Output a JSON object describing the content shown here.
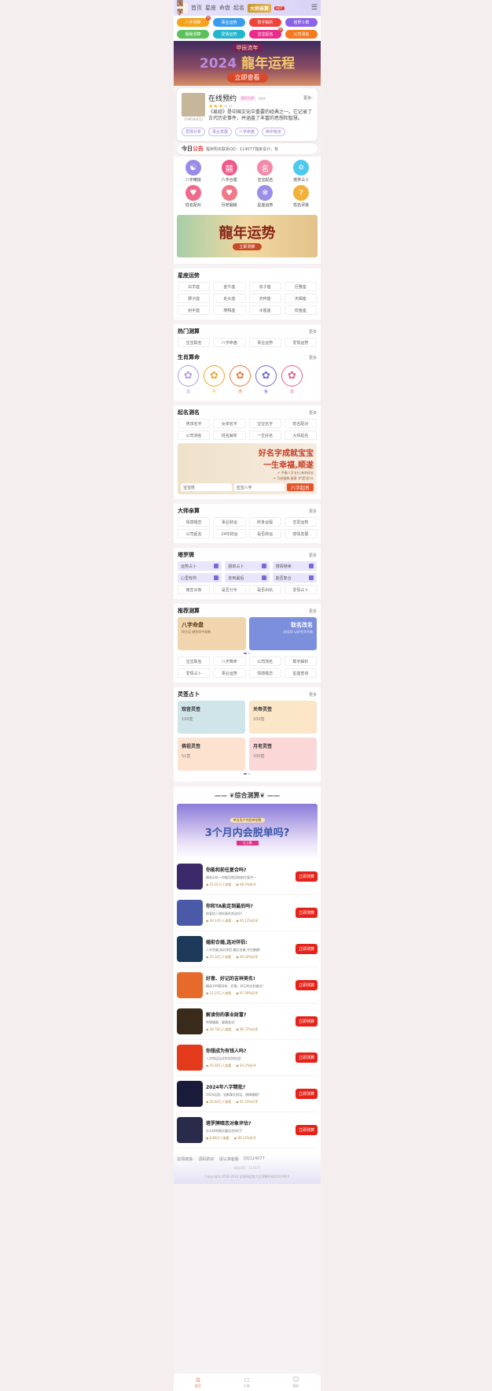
{
  "header": {
    "logo": "国学",
    "nav": [
      "首页",
      "星座",
      "命盘",
      "起名"
    ],
    "master_label": "大师亲算",
    "hot_badge": "HOT",
    "menu_icon": "menu-icon"
  },
  "quick_pills": [
    {
      "label": "八字测算",
      "color": "#f7a21b",
      "badge": "热"
    },
    {
      "label": "事业运势",
      "color": "#3a9bf0",
      "badge": ""
    },
    {
      "label": "数字解析",
      "color": "#f0423c",
      "badge": ""
    },
    {
      "label": "塔罗斗数",
      "color": "#8b63e6",
      "badge": ""
    },
    {
      "label": "姻缘测算",
      "color": "#5ac15a",
      "badge": ""
    },
    {
      "label": "爱情运势",
      "color": "#21b6cc",
      "badge": ""
    },
    {
      "label": "宝宝起名",
      "color": "#ec2a8c",
      "badge": "热"
    },
    {
      "label": "公司测名",
      "color": "#f5791f",
      "badge": ""
    }
  ],
  "hero": {
    "sub": "甲辰流年",
    "year": "2024",
    "title": "龍年运程",
    "button": "立即查看"
  },
  "appointment": {
    "title": "在线预约",
    "tag": "国学大师",
    "small": "最会评",
    "more": "更多",
    "year_caption": "(1965年9月)",
    "rating": 3,
    "rating_max": 5,
    "description": "《易经》是中国文化中重要的经典之一。它记录了古代历史事件，并涵盖了丰富的思想和智慧。",
    "tags": [
      "爱情分析",
      "事业发展",
      "八字命盘",
      "命中桃花"
    ]
  },
  "notice": {
    "prefix": "今日",
    "highlight": "公告",
    "text": "程序购买联系QQ：114077独家设计，有"
  },
  "icon_grid": [
    {
      "label": "八字精批",
      "glyph": "☯",
      "color": "#9a8ae8",
      "icon": "yin-yang-icon"
    },
    {
      "label": "八字合婚",
      "glyph": "囍",
      "color": "#ee5a8a",
      "icon": "double-happiness-icon"
    },
    {
      "label": "宝宝起名",
      "glyph": "名",
      "color": "#f28aa8",
      "icon": "name-scroll-icon"
    },
    {
      "label": "塔罗占卜",
      "glyph": "✡",
      "color": "#4ec9ee",
      "icon": "star-icon"
    },
    {
      "label": "姓名配对",
      "glyph": "♥",
      "color": "#f06a8a",
      "icon": "heart-icon"
    },
    {
      "label": "月老姻缘",
      "glyph": "♥",
      "color": "#f07a8a",
      "icon": "heart-cat-icon"
    },
    {
      "label": "星座运势",
      "glyph": "❄",
      "color": "#9a8ee6",
      "icon": "snowflake-icon"
    },
    {
      "label": "姓名评批",
      "glyph": "?",
      "color": "#f2b23a",
      "icon": "question-calendar-icon"
    }
  ],
  "promo_banner": {
    "title": "龍年运势",
    "button": "立即测算"
  },
  "constellation": {
    "title": "星座运势",
    "items": [
      "白羊座",
      "金牛座",
      "双子座",
      "巨蟹座",
      "狮子座",
      "处女座",
      "天秤座",
      "天蝎座",
      "射手座",
      "摩羯座",
      "水瓶座",
      "双鱼座"
    ]
  },
  "hot": {
    "title": "热门测算",
    "more": "更多",
    "items": [
      "宝宝取名",
      "八字命盘",
      "事业运势",
      "爱情运势"
    ]
  },
  "zodiac": {
    "title": "生肖算命",
    "more": "更多",
    "items": [
      {
        "name": "鼠",
        "color": "#b39ae8"
      },
      {
        "name": "牛",
        "color": "#f3a62a"
      },
      {
        "name": "虎",
        "color": "#ee7a3a"
      },
      {
        "name": "兔",
        "color": "#6b6bdf"
      },
      {
        "name": "龙",
        "color": "#ee5a8a"
      }
    ]
  },
  "naming": {
    "title": "起名测名",
    "more": "更多",
    "items": [
      "男孩名字",
      "女孩名字",
      "宝宝名字",
      "姓名配对",
      "公司测名",
      "姓名解析",
      "一生好名",
      "大师起名"
    ],
    "banner": {
      "line1": "好名字成就宝宝",
      "line2": "一生幸福,顺遂",
      "check1": "平衡八字五行,有利成长",
      "check2": "引经据典,寓意 字\\音\\形\\义",
      "surname_placeholder": "宝宝姓",
      "bazi_placeholder": "宝宝八字",
      "submit": "八字起名"
    }
  },
  "master": {
    "title": "大师亲算",
    "more": "更多",
    "items": [
      "情感婚恋",
      "事业财运",
      "终身运程",
      "恋爱运势",
      "公司起名",
      "24年财运",
      "是否转运",
      "感情发展"
    ]
  },
  "tarot": {
    "title": "塔罗牌",
    "more": "更多",
    "featured": [
      "运势占卜",
      "脱单占卜",
      "感情继续",
      "心里有你",
      "走到最后",
      "能否复合"
    ],
    "items": [
      "暗恋对象",
      "是否分手",
      "是否出轨",
      "爱情占卜"
    ]
  },
  "recommend": {
    "title": "推荐测算",
    "more": "更多",
    "cards": [
      {
        "title": "八字命盘",
        "sub": "知大运 避免命中劫数",
        "bg": "#f0d5ae"
      },
      {
        "title": "取名改名",
        "sub": "好运伴 以好名字开始",
        "bg": "#7c8fdc"
      }
    ],
    "items": [
      "宝宝取名",
      "八字算命",
      "公司测名",
      "数字解析",
      "爱情占卜",
      "事业运势",
      "情感婚恋",
      "星座查询"
    ]
  },
  "lingqian": {
    "title": "灵签占卜",
    "more": "更多",
    "cards": [
      {
        "title": "观音灵签",
        "count": "100签",
        "bg": "#cfe5ea"
      },
      {
        "title": "关帝灵签",
        "count": "100签",
        "bg": "#fbe6c8"
      },
      {
        "title": "佛祖灵签",
        "count": "51签",
        "bg": "#fde3cf"
      },
      {
        "title": "月老灵签",
        "count": "100签",
        "bg": "#fbd7d7"
      }
    ]
  },
  "composite": {
    "title": "综合测算",
    "banner": {
      "tag": "单身用户的脱单秘籍",
      "title": "3个月内会脱单吗?",
      "button": "马上算"
    },
    "list": [
      {
        "title": "你能和前任复合吗?",
        "desc": "精准分析一你能否挽回和前任复合一",
        "views": "25.01万人查看",
        "rate": "98.4%好评",
        "bg": "#3a2a6a",
        "button": "立即测算"
      },
      {
        "title": "你和TA能走到最后吗?",
        "desc": "你爱的人和你真的合适吗?",
        "views": "40.14万人查看",
        "rate": "95.12%好评",
        "bg": "#4a5aa8",
        "button": "立即测算"
      },
      {
        "title": "婚前合婚,选对伴侣:",
        "desc": "八字合婚,选对伴侣,婚后合婚,守住婚姻!",
        "views": "25.10万人查看",
        "rate": "90.02%好评",
        "bg": "#1e3a5a",
        "button": "立即测算"
      },
      {
        "title": "好意、好记的吉祥美名!",
        "desc": "精选100套好听、好意、好记的吉祥美名!",
        "views": "11.25万人查看",
        "rate": "97.56%好评",
        "bg": "#e66a2a",
        "button": "立即测算"
      },
      {
        "title": "解读你的事业财富?",
        "desc": "师情婚姻、健康变化!",
        "views": "38.78万人查看",
        "rate": "86.72%好评",
        "bg": "#3a2a1a",
        "button": "立即测算"
      },
      {
        "title": "你想成为有钱人吗?",
        "desc": "八字财运告诉你发财机会!",
        "views": "45.66万人查看",
        "rate": "93.2%好评",
        "bg": "#e23a1a",
        "button": "立即测算"
      },
      {
        "title": "2024年八字精批?",
        "desc": "2024运势、化解事业财运、感情婚姻?",
        "views": "26.64万人查看",
        "rate": "91.25%好评",
        "bg": "#1a1a3a",
        "button": "立即测算"
      },
      {
        "title": "塔罗牌暗恋对象评估?",
        "desc": "什么样的模式最适合你们?",
        "views": "8.89万人查看",
        "rate": "90.12%好评",
        "bg": "#2a2a4a",
        "button": "立即测算"
      }
    ]
  },
  "footer": {
    "links": [
      "友情链接:",
      "源码购买",
      "请认准客服",
      "QQ114077"
    ],
    "qq": "商务QQ：114077",
    "copyright": "Copyright 2016-2024 站源网运势大全测算系统2024V8.0"
  },
  "tabbar": [
    {
      "label": "首页",
      "glyph": "⌂",
      "active": true,
      "icon": "home-icon"
    },
    {
      "label": "订单",
      "glyph": "⚏",
      "active": false,
      "icon": "order-icon"
    },
    {
      "label": "我的",
      "glyph": "☺",
      "active": false,
      "icon": "profile-icon"
    }
  ]
}
